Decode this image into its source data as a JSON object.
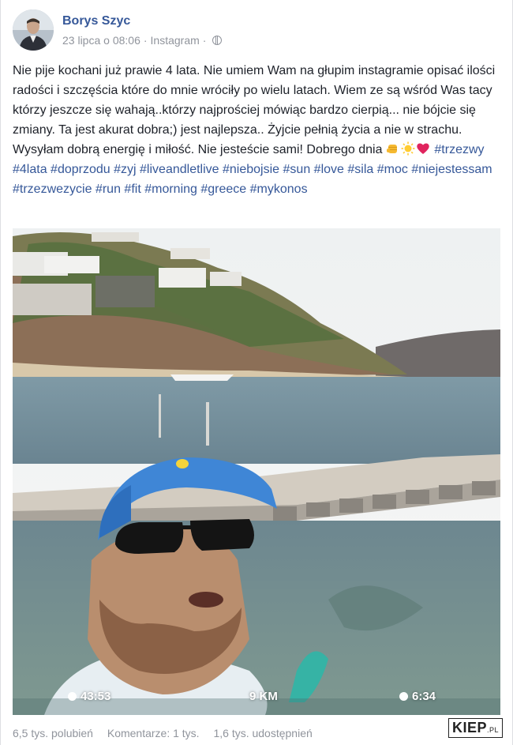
{
  "post": {
    "author": "Borys Szyc",
    "date": "23 lipca o 08:06",
    "source": "Instagram",
    "separator": "·",
    "text_main": "Nie pije kochani już prawie 4 lata. Nie umiem Wam na głupim instagramie opisać ilości radości i szczęścia które do mnie wróciły po wielu latach. Wiem ze są wśród Was tacy którzy jeszcze się wahają..którzy najprościej mówiąc bardzo cierpią... nie bójcie się zmiany. Ta jest akurat dobra;) jest najlepsza.. Żyjcie pełnią życia a nie w strachu. Wysyłam dobrą energię i miłość. Nie jesteście sami! Dobrego dnia",
    "hashtags": [
      "#trzezwy",
      "#4lata",
      "#doprzodu",
      "#zyj",
      "#liveandletlive",
      "#niebojsie",
      "#sun",
      "#love",
      "#sila",
      "#moc",
      "#niejestessam",
      "#trzezwezycie",
      "#run",
      "#fit",
      "#morning",
      "#greece",
      "#mykonos"
    ],
    "emojis": [
      "fist-emoji",
      "sun-emoji",
      "heart-emoji"
    ]
  },
  "photo_overlay": {
    "time_left": "43:53",
    "distance": "9 KM",
    "time_right": "6:34"
  },
  "stats": {
    "likes": "6,5 tys. polubień",
    "comments": "Komentarze: 1 tys.",
    "shares": "1,6 tys. udostępnień"
  },
  "watermark": {
    "main": "KIEP",
    "suffix": ".PL"
  },
  "colors": {
    "link": "#365899",
    "text": "#1d2129",
    "meta": "#90949c"
  }
}
